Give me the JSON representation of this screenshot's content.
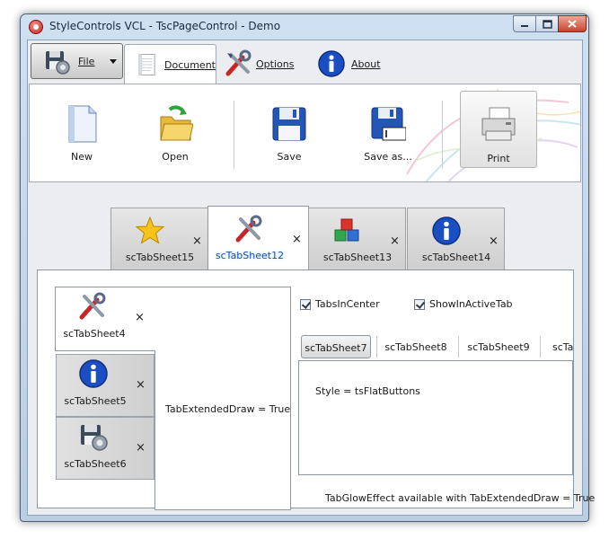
{
  "window": {
    "title": "StyleControls VCL - TscPageControl - Demo"
  },
  "ribbon": {
    "file_label": "File",
    "tabs": [
      {
        "label": "Document",
        "icon": "document-icon",
        "active": true
      },
      {
        "label": "Options",
        "icon": "tools-icon",
        "active": false
      },
      {
        "label": "About",
        "icon": "info-icon",
        "active": false
      }
    ],
    "buttons": [
      {
        "label": "New",
        "icon": "new-document-icon"
      },
      {
        "label": "Open",
        "icon": "open-folder-icon"
      },
      {
        "label": "Save",
        "icon": "floppy-disk-icon"
      },
      {
        "label": "Save as...",
        "icon": "save-as-icon"
      },
      {
        "label": "Print",
        "icon": "printer-icon"
      }
    ]
  },
  "page_tabs": [
    {
      "label": "scTabSheet15",
      "icon": "star-icon",
      "close": "×"
    },
    {
      "label": "scTabSheet12",
      "icon": "tools-icon",
      "close": "×",
      "active": true
    },
    {
      "label": "scTabSheet13",
      "icon": "cubes-icon",
      "close": "×"
    },
    {
      "label": "scTabSheet14",
      "icon": "info-icon",
      "close": "×"
    }
  ],
  "side_tabs": [
    {
      "label": "scTabSheet4",
      "icon": "tools-icon",
      "close": "×",
      "active": true
    },
    {
      "label": "scTabSheet5",
      "icon": "info-icon",
      "close": "×"
    },
    {
      "label": "scTabSheet6",
      "icon": "floppy-gear-icon",
      "close": "×"
    }
  ],
  "side_page_text": "TabExtendedDraw = True",
  "options": {
    "tabs_in_center": {
      "label": "TabsInCenter",
      "checked": true
    },
    "show_in_active_tab": {
      "label": "ShowInActiveTab",
      "checked": true
    }
  },
  "flat_tabs": [
    {
      "label": "scTabSheet7",
      "selected": true
    },
    {
      "label": "scTabSheet8"
    },
    {
      "label": "scTabSheet9"
    },
    {
      "label": "scTa"
    }
  ],
  "flat_page_text": "Style = tsFlatButtons",
  "glow_note": "TabGlowEffect available with TabExtendedDraw = True"
}
